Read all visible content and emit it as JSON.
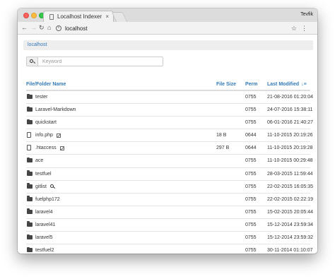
{
  "browser": {
    "tab_title": "Localhost Indexer",
    "tab_close": "×",
    "profile_name": "Tevfik",
    "back_glyph": "←",
    "forward_glyph": "→",
    "reload_glyph": "↻",
    "home_glyph": "⌂",
    "info_glyph": "i",
    "url": "localhost",
    "bookmark_glyph": "☆",
    "menu_glyph": "⋮"
  },
  "page": {
    "breadcrumb": "localhost",
    "search": {
      "placeholder": "Keyword",
      "icon": "search-icon"
    },
    "table": {
      "columns": {
        "name": "File/Folder Name",
        "size": "File Size",
        "perm": "Perm",
        "modified": "Last Modified",
        "sort_glyph": "↓≡"
      },
      "rows": [
        {
          "type": "folder",
          "name": "tester",
          "size": "",
          "perm": "0755",
          "modified": "21-08-2016 01:20:04"
        },
        {
          "type": "folder",
          "name": "Laravel-Markdown",
          "size": "",
          "perm": "0755",
          "modified": "24-07-2016 15:38:11"
        },
        {
          "type": "folder",
          "name": "quickstart",
          "size": "",
          "perm": "0755",
          "modified": "06-01-2016 21:40:27"
        },
        {
          "type": "file",
          "name": "info.php",
          "size": "18 B",
          "perm": "0644",
          "modified": "11-10-2015 20:19:26",
          "action": "edit-icon"
        },
        {
          "type": "file",
          "name": ".htaccess",
          "size": "297 B",
          "perm": "0644",
          "modified": "11-10-2015 20:19:28",
          "action": "edit-icon"
        },
        {
          "type": "folder",
          "name": "ace",
          "size": "",
          "perm": "0755",
          "modified": "11-10-2015 00:29:48"
        },
        {
          "type": "folder",
          "name": "testfuel",
          "size": "",
          "perm": "0755",
          "modified": "28-03-2015 11:59:44"
        },
        {
          "type": "folder",
          "name": "gitlist",
          "size": "",
          "perm": "0755",
          "modified": "22-02-2015 16:05:35",
          "action": "search-icon"
        },
        {
          "type": "folder",
          "name": "fuelphp172",
          "size": "",
          "perm": "0755",
          "modified": "22-02-2015 02:22:19"
        },
        {
          "type": "folder",
          "name": "laravel4",
          "size": "",
          "perm": "0755",
          "modified": "15-02-2015 20:05:44"
        },
        {
          "type": "folder",
          "name": "laravel41",
          "size": "",
          "perm": "0755",
          "modified": "15-12-2014 23:59:34"
        },
        {
          "type": "folder",
          "name": "laravel5",
          "size": "",
          "perm": "0755",
          "modified": "15-12-2014 23:59:32"
        },
        {
          "type": "folder",
          "name": "testfuel2",
          "size": "",
          "perm": "0755",
          "modified": "30-11-2014 01:10:07"
        }
      ]
    }
  }
}
